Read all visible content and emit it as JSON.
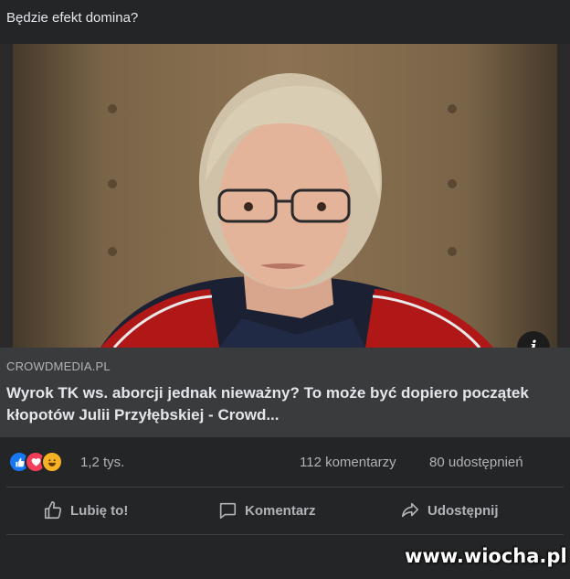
{
  "post": {
    "text": "Będzie efekt domina?"
  },
  "link": {
    "domain": "CROWDMEDIA.PL",
    "title": "Wyrok TK ws. aborcji jednak nieważny? To może być dopiero początek kłopotów Julii Przyłębskiej - Crowd..."
  },
  "stats": {
    "reactions": "1,2 tys.",
    "comments": "112 komentarzy",
    "shares": "80 udostępnień",
    "reaction_icons": [
      "like-icon",
      "love-icon",
      "haha-icon"
    ]
  },
  "actions": {
    "like": "Lubię to!",
    "comment": "Komentarz",
    "share": "Udostępnij"
  },
  "watermark": "www.wiocha.pl",
  "colors": {
    "card": "#242526",
    "meta": "#3a3b3c",
    "like": "#1877f2",
    "love": "#f33e58",
    "haha": "#f7b125"
  }
}
